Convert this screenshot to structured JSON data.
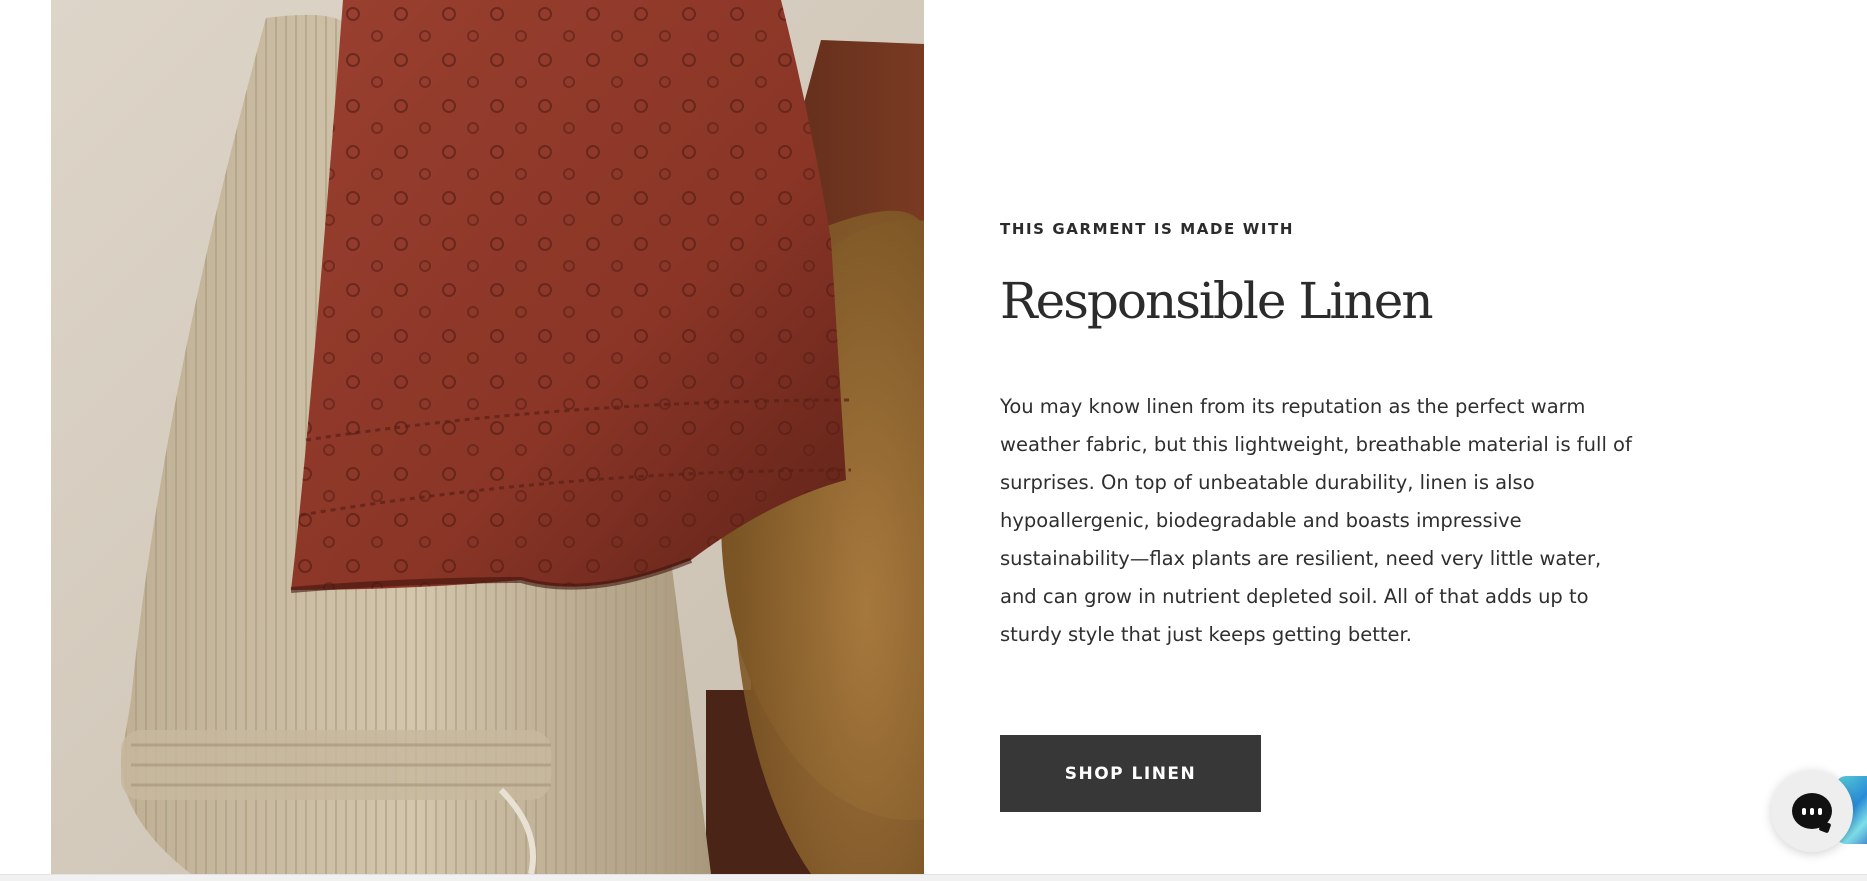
{
  "feature": {
    "eyebrow": "THIS GARMENT IS MADE WITH",
    "title": "Responsible Linen",
    "body": "You may know linen from its reputation as the perfect warm weather fabric, but this lightweight, breathable material is full of surprises. On top of unbeatable durability, linen is also hypoallergenic, biodegradable and boasts impressive sustainability—flax plants are resilient, need very little water, and can grow in nutrient depleted soil. All of that adds up to sturdy style that just keeps getting better.",
    "cta_label": "SHOP LINEN",
    "image_icon": "linen-garments-photo"
  },
  "chat": {
    "icon": "chat-bubble-icon"
  },
  "colors": {
    "button_bg": "#373737",
    "button_text": "#ffffff",
    "text": "#2b2b2b",
    "rust_linen": "#8e3a2b",
    "natural_linen": "#cdbfa6"
  }
}
